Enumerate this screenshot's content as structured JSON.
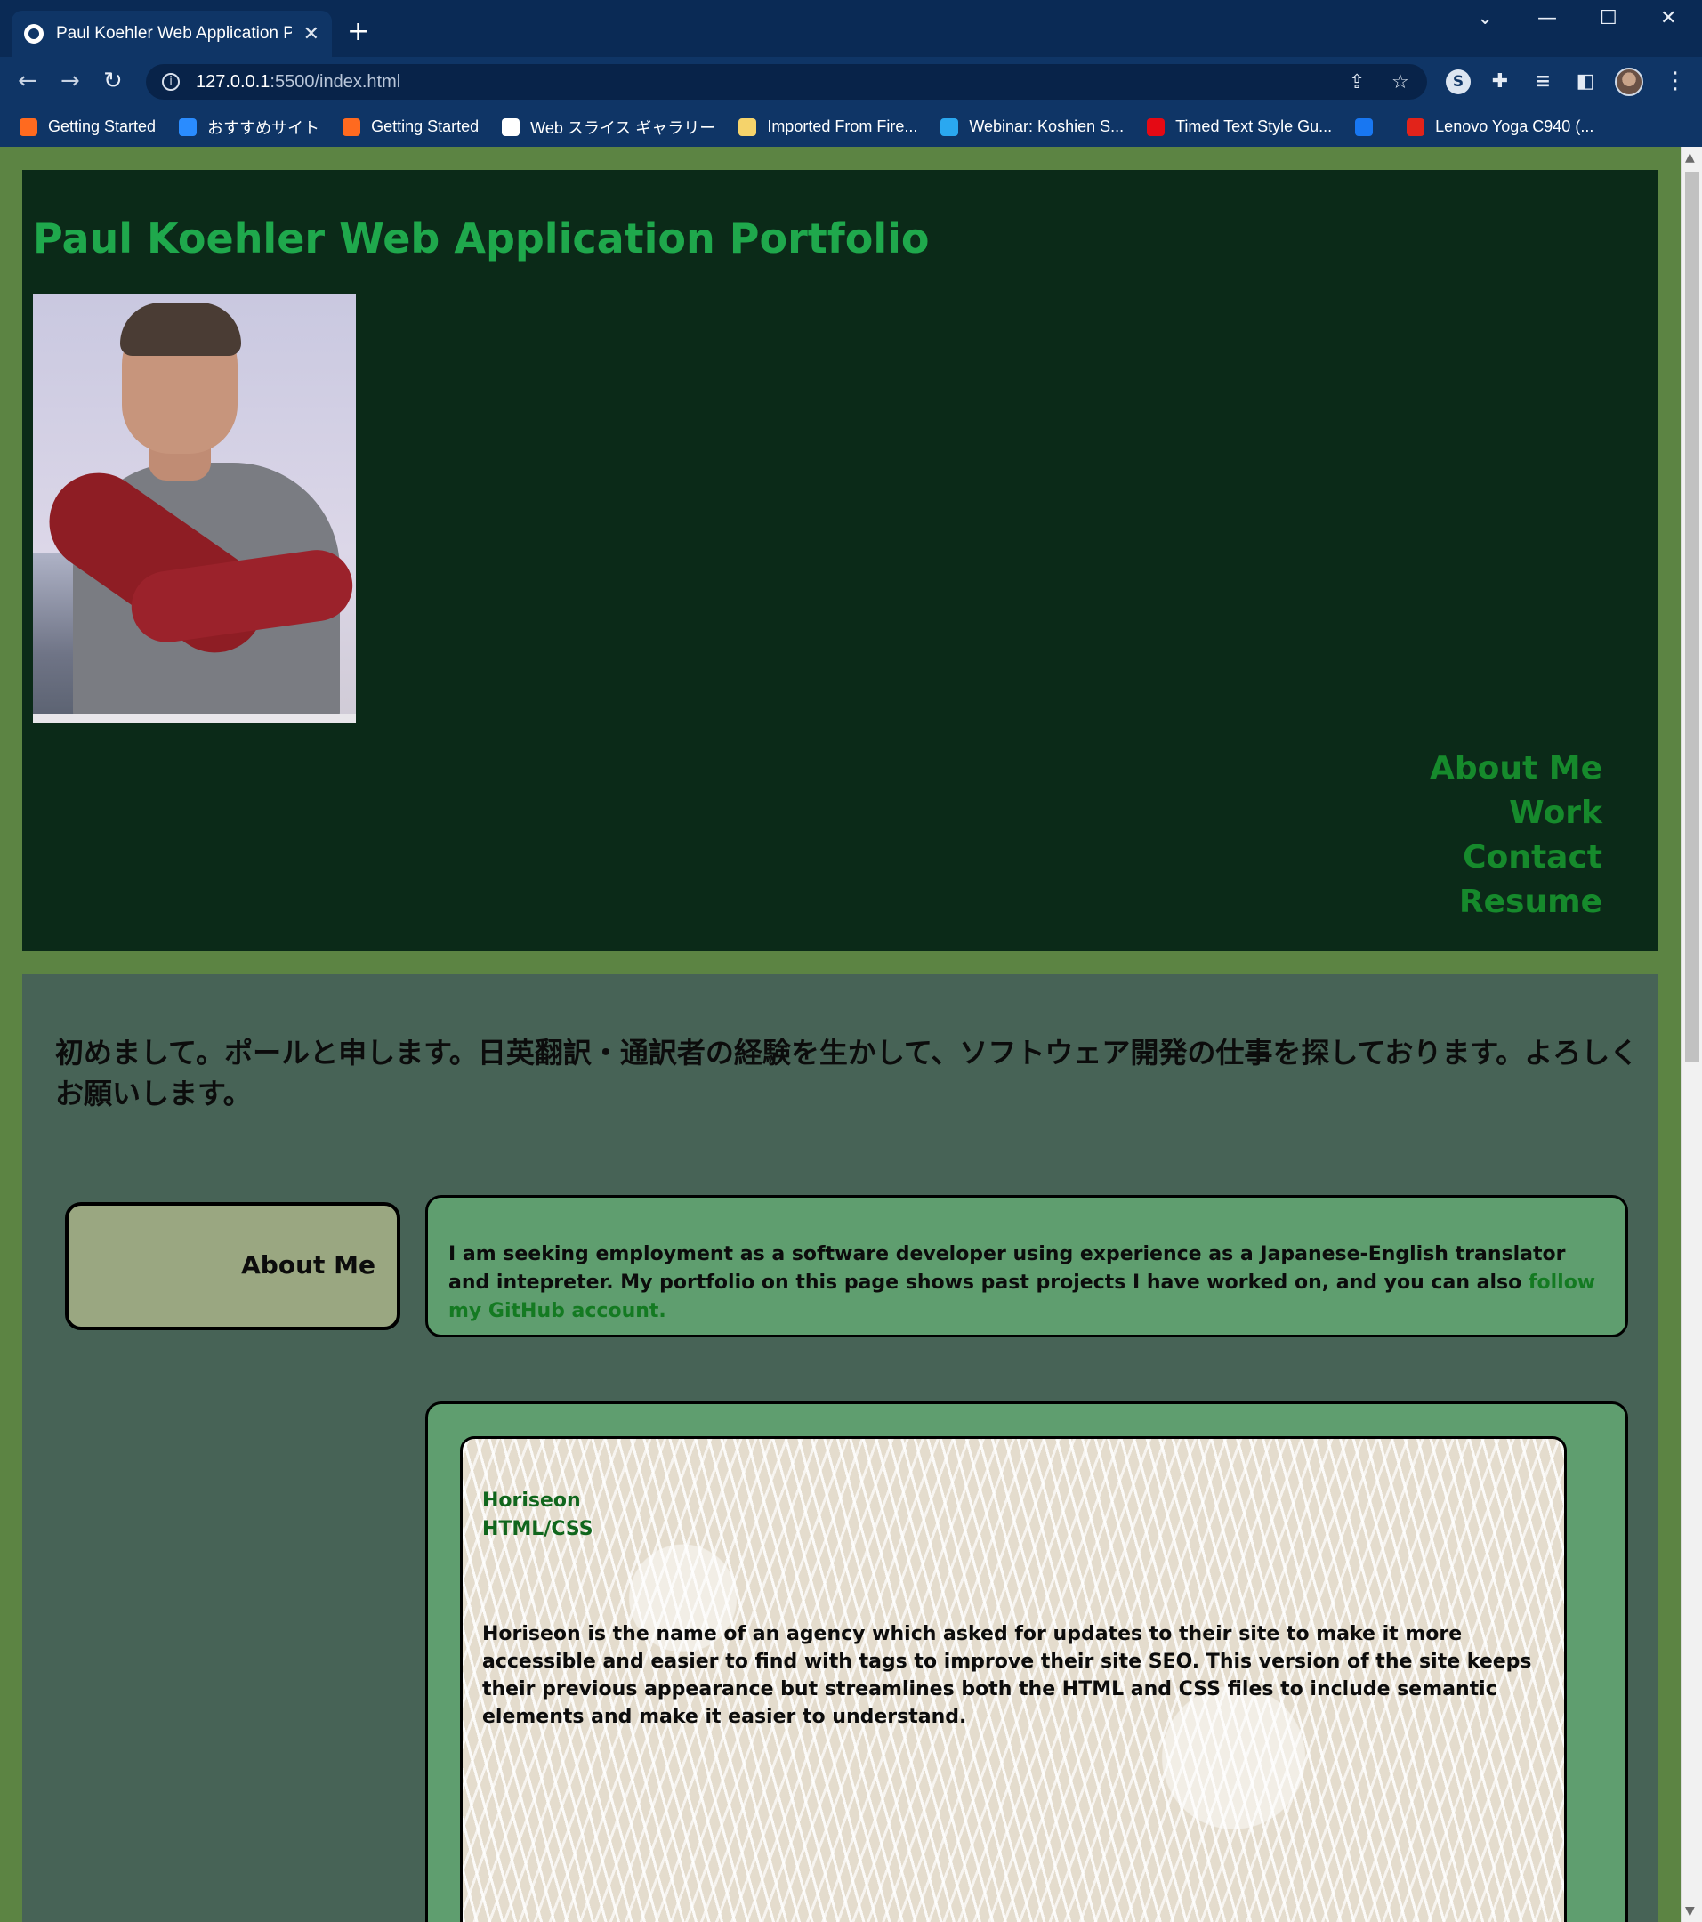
{
  "browser": {
    "tab_title": "Paul Koehler Web Application Portfolio",
    "new_tab_symbol": "+",
    "url_host": "127.0.0.1",
    "url_rest": ":5500/index.html",
    "bookmarks": [
      {
        "label": "Getting Started",
        "icon": "firefox-icon",
        "color": "#ff6a1f"
      },
      {
        "label": "おすすめサイト",
        "icon": "bing-icon",
        "color": "#2a8cff"
      },
      {
        "label": "Getting Started",
        "icon": "firefox-icon",
        "color": "#ff6a1f"
      },
      {
        "label": "Web スライス ギャラリー",
        "icon": "web-slice-icon",
        "color": "#ffffff"
      },
      {
        "label": "Imported From Fire...",
        "icon": "folder-icon",
        "color": "#f5d36b"
      },
      {
        "label": "Webinar: Koshien S...",
        "icon": "webinar-icon",
        "color": "#2aa8f0"
      },
      {
        "label": "Timed Text Style Gu...",
        "icon": "netflix-icon",
        "color": "#e50914"
      },
      {
        "label": "",
        "icon": "facebook-icon",
        "color": "#1877f2"
      },
      {
        "label": "Lenovo Yoga C940 (...",
        "icon": "lenovo-icon",
        "color": "#e2231a"
      }
    ]
  },
  "header": {
    "title": "Paul Koehler Web Application Portfolio",
    "nav": [
      "About Me",
      "Work",
      "Contact",
      "Resume"
    ]
  },
  "intro": {
    "japanese": "初めまして。ポールと申します。日英翻訳・通訳者の経験を生かして、ソフトウェア開発の仕事を探しております。よろしくお願いします。"
  },
  "about": {
    "label": "About Me",
    "text": "I am seeking employment as a software developer using experience as a Japanese-English translator and intepreter. My portfolio on this page shows past projects I have worked on, and you can also ",
    "link_text": "follow my GitHub account."
  },
  "work": {
    "projects": [
      {
        "name": "Horiseon",
        "tech": "HTML/CSS",
        "description": "Horiseon is the name of an agency which asked for updates to their site to make it more accessible and easier to find with tags to improve their site SEO. This version of the site keeps their previous appearance but streamlines both the HTML and CSS files to include semantic elements and make it easier to understand."
      }
    ]
  }
}
